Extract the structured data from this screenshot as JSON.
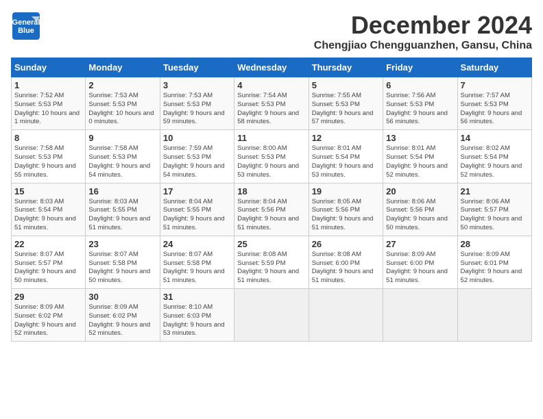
{
  "logo": {
    "line1": "General",
    "line2": "Blue"
  },
  "title": "December 2024",
  "location": "Chengjiao Chengguanzhen, Gansu, China",
  "days_of_week": [
    "Sunday",
    "Monday",
    "Tuesday",
    "Wednesday",
    "Thursday",
    "Friday",
    "Saturday"
  ],
  "weeks": [
    [
      {
        "day": 1,
        "sunrise": "7:52 AM",
        "sunset": "5:53 PM",
        "daylight": "10 hours and 1 minute."
      },
      {
        "day": 2,
        "sunrise": "7:53 AM",
        "sunset": "5:53 PM",
        "daylight": "10 hours and 0 minutes."
      },
      {
        "day": 3,
        "sunrise": "7:53 AM",
        "sunset": "5:53 PM",
        "daylight": "9 hours and 59 minutes."
      },
      {
        "day": 4,
        "sunrise": "7:54 AM",
        "sunset": "5:53 PM",
        "daylight": "9 hours and 58 minutes."
      },
      {
        "day": 5,
        "sunrise": "7:55 AM",
        "sunset": "5:53 PM",
        "daylight": "9 hours and 57 minutes."
      },
      {
        "day": 6,
        "sunrise": "7:56 AM",
        "sunset": "5:53 PM",
        "daylight": "9 hours and 56 minutes."
      },
      {
        "day": 7,
        "sunrise": "7:57 AM",
        "sunset": "5:53 PM",
        "daylight": "9 hours and 56 minutes."
      }
    ],
    [
      {
        "day": 8,
        "sunrise": "7:58 AM",
        "sunset": "5:53 PM",
        "daylight": "9 hours and 55 minutes."
      },
      {
        "day": 9,
        "sunrise": "7:58 AM",
        "sunset": "5:53 PM",
        "daylight": "9 hours and 54 minutes."
      },
      {
        "day": 10,
        "sunrise": "7:59 AM",
        "sunset": "5:53 PM",
        "daylight": "9 hours and 54 minutes."
      },
      {
        "day": 11,
        "sunrise": "8:00 AM",
        "sunset": "5:53 PM",
        "daylight": "9 hours and 53 minutes."
      },
      {
        "day": 12,
        "sunrise": "8:01 AM",
        "sunset": "5:54 PM",
        "daylight": "9 hours and 53 minutes."
      },
      {
        "day": 13,
        "sunrise": "8:01 AM",
        "sunset": "5:54 PM",
        "daylight": "9 hours and 52 minutes."
      },
      {
        "day": 14,
        "sunrise": "8:02 AM",
        "sunset": "5:54 PM",
        "daylight": "9 hours and 52 minutes."
      }
    ],
    [
      {
        "day": 15,
        "sunrise": "8:03 AM",
        "sunset": "5:54 PM",
        "daylight": "9 hours and 51 minutes."
      },
      {
        "day": 16,
        "sunrise": "8:03 AM",
        "sunset": "5:55 PM",
        "daylight": "9 hours and 51 minutes."
      },
      {
        "day": 17,
        "sunrise": "8:04 AM",
        "sunset": "5:55 PM",
        "daylight": "9 hours and 51 minutes."
      },
      {
        "day": 18,
        "sunrise": "8:04 AM",
        "sunset": "5:56 PM",
        "daylight": "9 hours and 51 minutes."
      },
      {
        "day": 19,
        "sunrise": "8:05 AM",
        "sunset": "5:56 PM",
        "daylight": "9 hours and 51 minutes."
      },
      {
        "day": 20,
        "sunrise": "8:06 AM",
        "sunset": "5:56 PM",
        "daylight": "9 hours and 50 minutes."
      },
      {
        "day": 21,
        "sunrise": "8:06 AM",
        "sunset": "5:57 PM",
        "daylight": "9 hours and 50 minutes."
      }
    ],
    [
      {
        "day": 22,
        "sunrise": "8:07 AM",
        "sunset": "5:57 PM",
        "daylight": "9 hours and 50 minutes."
      },
      {
        "day": 23,
        "sunrise": "8:07 AM",
        "sunset": "5:58 PM",
        "daylight": "9 hours and 50 minutes."
      },
      {
        "day": 24,
        "sunrise": "8:07 AM",
        "sunset": "5:58 PM",
        "daylight": "9 hours and 51 minutes."
      },
      {
        "day": 25,
        "sunrise": "8:08 AM",
        "sunset": "5:59 PM",
        "daylight": "9 hours and 51 minutes."
      },
      {
        "day": 26,
        "sunrise": "8:08 AM",
        "sunset": "6:00 PM",
        "daylight": "9 hours and 51 minutes."
      },
      {
        "day": 27,
        "sunrise": "8:09 AM",
        "sunset": "6:00 PM",
        "daylight": "9 hours and 51 minutes."
      },
      {
        "day": 28,
        "sunrise": "8:09 AM",
        "sunset": "6:01 PM",
        "daylight": "9 hours and 52 minutes."
      }
    ],
    [
      {
        "day": 29,
        "sunrise": "8:09 AM",
        "sunset": "6:02 PM",
        "daylight": "9 hours and 52 minutes."
      },
      {
        "day": 30,
        "sunrise": "8:09 AM",
        "sunset": "6:02 PM",
        "daylight": "9 hours and 52 minutes."
      },
      {
        "day": 31,
        "sunrise": "8:10 AM",
        "sunset": "6:03 PM",
        "daylight": "9 hours and 53 minutes."
      },
      null,
      null,
      null,
      null
    ]
  ]
}
